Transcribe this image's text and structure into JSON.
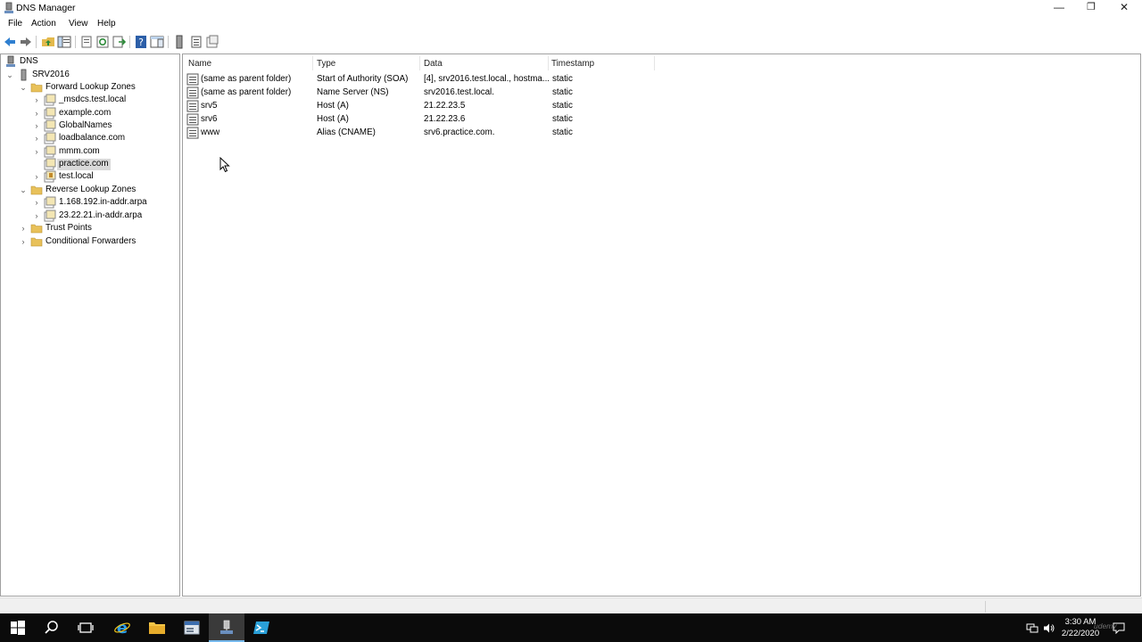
{
  "window": {
    "title": "DNS Manager"
  },
  "menu": [
    "File",
    "Action",
    "View",
    "Help"
  ],
  "tree": {
    "root": "DNS",
    "server": "SRV2016",
    "forward_zones_label": "Forward Lookup Zones",
    "forward_zones": [
      "_msdcs.test.local",
      "example.com",
      "GlobalNames",
      "loadbalance.com",
      "mmm.com",
      "practice.com",
      "test.local"
    ],
    "selected": "practice.com",
    "reverse_zones_label": "Reverse Lookup Zones",
    "reverse_zones": [
      "1.168.192.in-addr.arpa",
      "23.22.21.in-addr.arpa"
    ],
    "trust_points": "Trust Points",
    "conditional_forwarders": "Conditional Forwarders"
  },
  "columns": [
    "Name",
    "Type",
    "Data",
    "Timestamp"
  ],
  "records": [
    {
      "name": "(same as parent folder)",
      "type": "Start of Authority (SOA)",
      "data": "[4], srv2016.test.local., hostma...",
      "timestamp": "static"
    },
    {
      "name": "(same as parent folder)",
      "type": "Name Server (NS)",
      "data": "srv2016.test.local.",
      "timestamp": "static"
    },
    {
      "name": "srv5",
      "type": "Host (A)",
      "data": "21.22.23.5",
      "timestamp": "static"
    },
    {
      "name": "srv6",
      "type": "Host (A)",
      "data": "21.22.23.6",
      "timestamp": "static"
    },
    {
      "name": "www",
      "type": "Alias (CNAME)",
      "data": "srv6.practice.com.",
      "timestamp": "static"
    }
  ],
  "taskbar": {
    "time": "3:30 AM",
    "date": "2/22/2020",
    "watermark": "udemy"
  },
  "colors": {
    "accent": "#76b9ed",
    "selection": "#d9d9d9",
    "taskbar": "#0b0b0b"
  }
}
